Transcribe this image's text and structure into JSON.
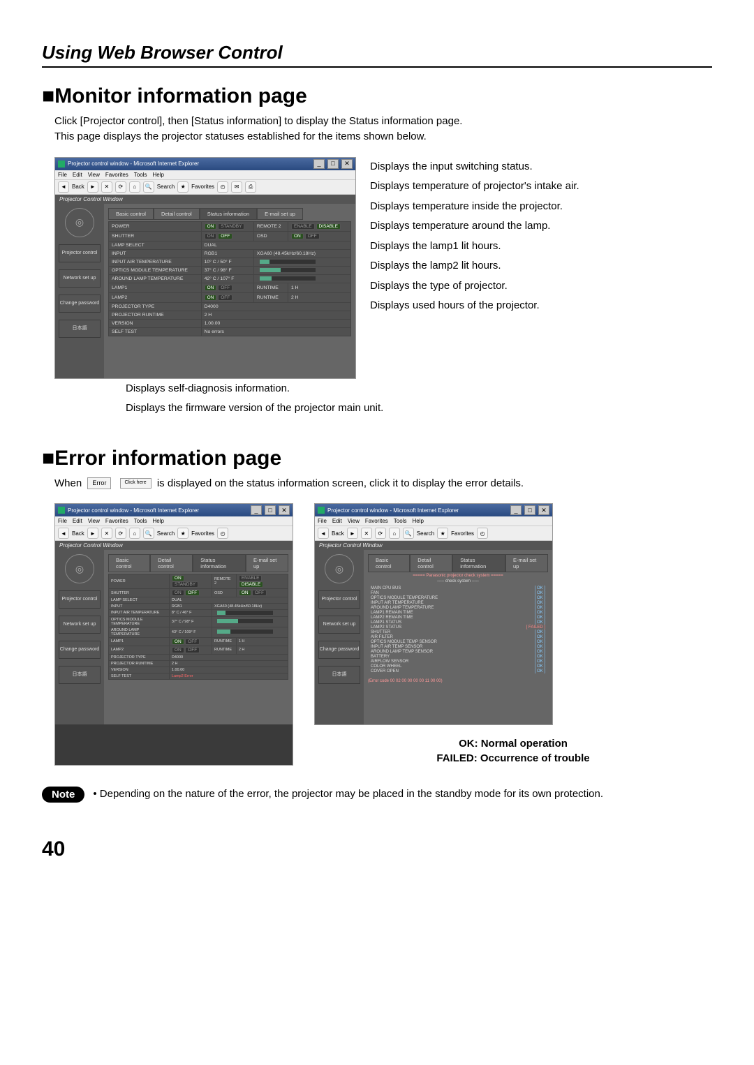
{
  "page_number": "40",
  "page_header": "Using Web Browser Control",
  "section1": {
    "heading": "■Monitor information page",
    "intro1": "Click [Projector control], then [Status information] to display the Status information page.",
    "intro2": "This page displays the projector statuses established for the items shown below."
  },
  "browser": {
    "title": "Projector control window - Microsoft Internet Explorer",
    "menus": [
      "File",
      "Edit",
      "View",
      "Favorites",
      "Tools",
      "Help"
    ],
    "toolbar": {
      "back": "Back",
      "search": "Search",
      "favorites": "Favorites"
    },
    "subheader": "Projector Control Window",
    "sidebar": {
      "item1": "Projector control",
      "item2": "Network set up",
      "item3": "Change password",
      "item4": "日本語"
    },
    "tabs": {
      "basic": "Basic control",
      "detail": "Detail control",
      "status": "Status information",
      "email": "E-mail set up"
    },
    "rows": {
      "power": "POWER",
      "power_on": "ON",
      "power_standby": "STANDBY",
      "remote": "REMOTE 2",
      "enable": "ENABLE",
      "disable": "DISABLE",
      "shutter": "SHUTTER",
      "shutter_on": "ON",
      "shutter_off": "OFF",
      "osd": "OSD",
      "osd_on": "ON",
      "osd_off": "OFF",
      "lamp_select": "LAMP SELECT",
      "lamp_select_val": "DUAL",
      "input": "INPUT",
      "input_val": "RGB1",
      "input_sig": "XGA60 (48.45kHz/60.18Hz)",
      "intake": "INPUT AIR TEMPERATURE",
      "intake_val": "10° C / 50° F",
      "optics": "OPTICS MODULE TEMPERATURE",
      "optics_val": "37° C / 98° F",
      "around": "AROUND LAMP TEMPERATURE",
      "around_val": "42° C / 107° F",
      "lamp1": "LAMP1",
      "lamp1_on": "ON",
      "lamp1_off": "OFF",
      "runtime": "RUNTIME",
      "lamp1_run": "1 H",
      "lamp2": "LAMP2",
      "lamp2_on": "ON",
      "lamp2_off": "OFF",
      "lamp2_run": "2 H",
      "ptype": "PROJECTOR TYPE",
      "ptype_val": "D4000",
      "pruntime": "PROJECTOR RUNTIME",
      "pruntime_val": "2 H",
      "version": "VERSION",
      "version_val": "1.00.00",
      "selftest": "SELF TEST",
      "selftest_val": "No errors"
    }
  },
  "annotations_right": {
    "a1": "Displays the input switching status.",
    "a2": "Displays temperature of projector's intake air.",
    "a3": "Displays temperature inside the projector.",
    "a4": "Displays temperature around the lamp.",
    "a5": "Displays the lamp1 lit hours.",
    "a6": "Displays the lamp2 lit hours.",
    "a7": "Displays the type of projector.",
    "a8": "Displays used hours of the projector."
  },
  "annotations_below": {
    "b1": "Displays self-diagnosis information.",
    "b2": "Displays the firmware version of the projector main unit."
  },
  "section2": {
    "heading": "■Error information page",
    "prefix": "When ",
    "btn_error": "Error",
    "btn_click": "Click here",
    "suffix": " is displayed on the status information screen, click it to display the error details."
  },
  "error_browser1": {
    "intake_val": "8° C / 46° F",
    "optics_val": "37° C / 98° F",
    "around_val": "43° C / 109° F",
    "lamp1_run": "1 H",
    "lamp2_run": "2 H",
    "selftest_red": "Lamp2 Error"
  },
  "error_browser2": {
    "check_header": "===== Panasonic projector check system =====",
    "check_sub": "----- check system -----",
    "items": [
      "MAIN CPU BUS",
      "FAN",
      "OPTICS MODULE TEMPERATURE",
      "INPUT AIR TEMPERATURE",
      "AROUND LAMP TEMPERATURE",
      "LAMP1 REMAIN TIME",
      "LAMP2 REMAIN TIME",
      "LAMP1 STATUS",
      "LAMP2 STATUS",
      "SHUTTER",
      "AIR FILTER",
      "OPTICS MODULE TEMP SENSOR",
      "INPUT AIR TEMP SENSOR",
      "AROUND LAMP TEMP SENSOR",
      "BATTERY",
      "AIRFLOW SENSOR",
      "COLOR WHEEL",
      "COVER OPEN"
    ],
    "ok": "[ OK ]",
    "failed": "[ FAILED ]",
    "errcode": "(Error code 00 02 00 00 00 00 11 00 00)"
  },
  "legend": {
    "line1": "OK: Normal operation",
    "line2": "FAILED: Occurrence of trouble"
  },
  "note": {
    "label": "Note",
    "text": "• Depending on the nature of the error, the projector may be placed in the standby mode for its own protection."
  }
}
